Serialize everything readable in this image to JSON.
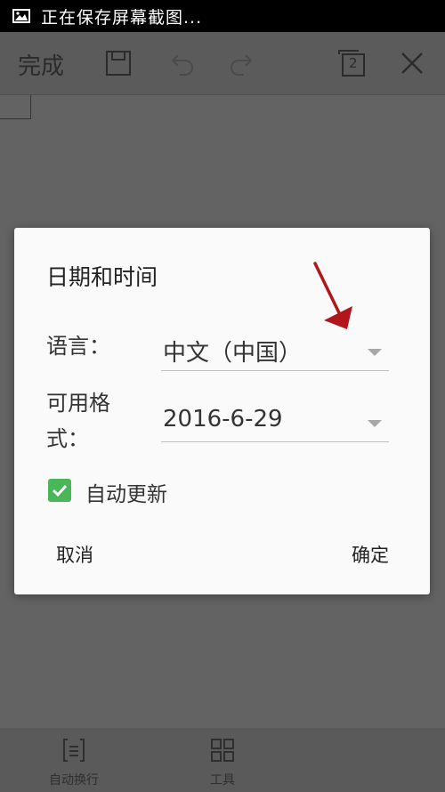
{
  "status_bar": {
    "text": "正在保存屏幕截图..."
  },
  "toolbar": {
    "done_label": "完成",
    "page_count": "2"
  },
  "dialog": {
    "title": "日期和时间",
    "language_label": "语言：",
    "language_value": "中文（中国）",
    "format_label_line1": "可用格",
    "format_label_line2": "式：",
    "format_value": "2016-6-29",
    "auto_update_label": "自动更新",
    "auto_update_checked": true,
    "cancel_label": "取消",
    "ok_label": "确定"
  },
  "bottom_bar": {
    "items": [
      {
        "label": "自动换行",
        "icon": "wrap-icon"
      },
      {
        "label": "工具",
        "icon": "grid-icon"
      }
    ]
  },
  "colors": {
    "checkbox": "#49b65a",
    "annotation_arrow": "#b3151c"
  }
}
